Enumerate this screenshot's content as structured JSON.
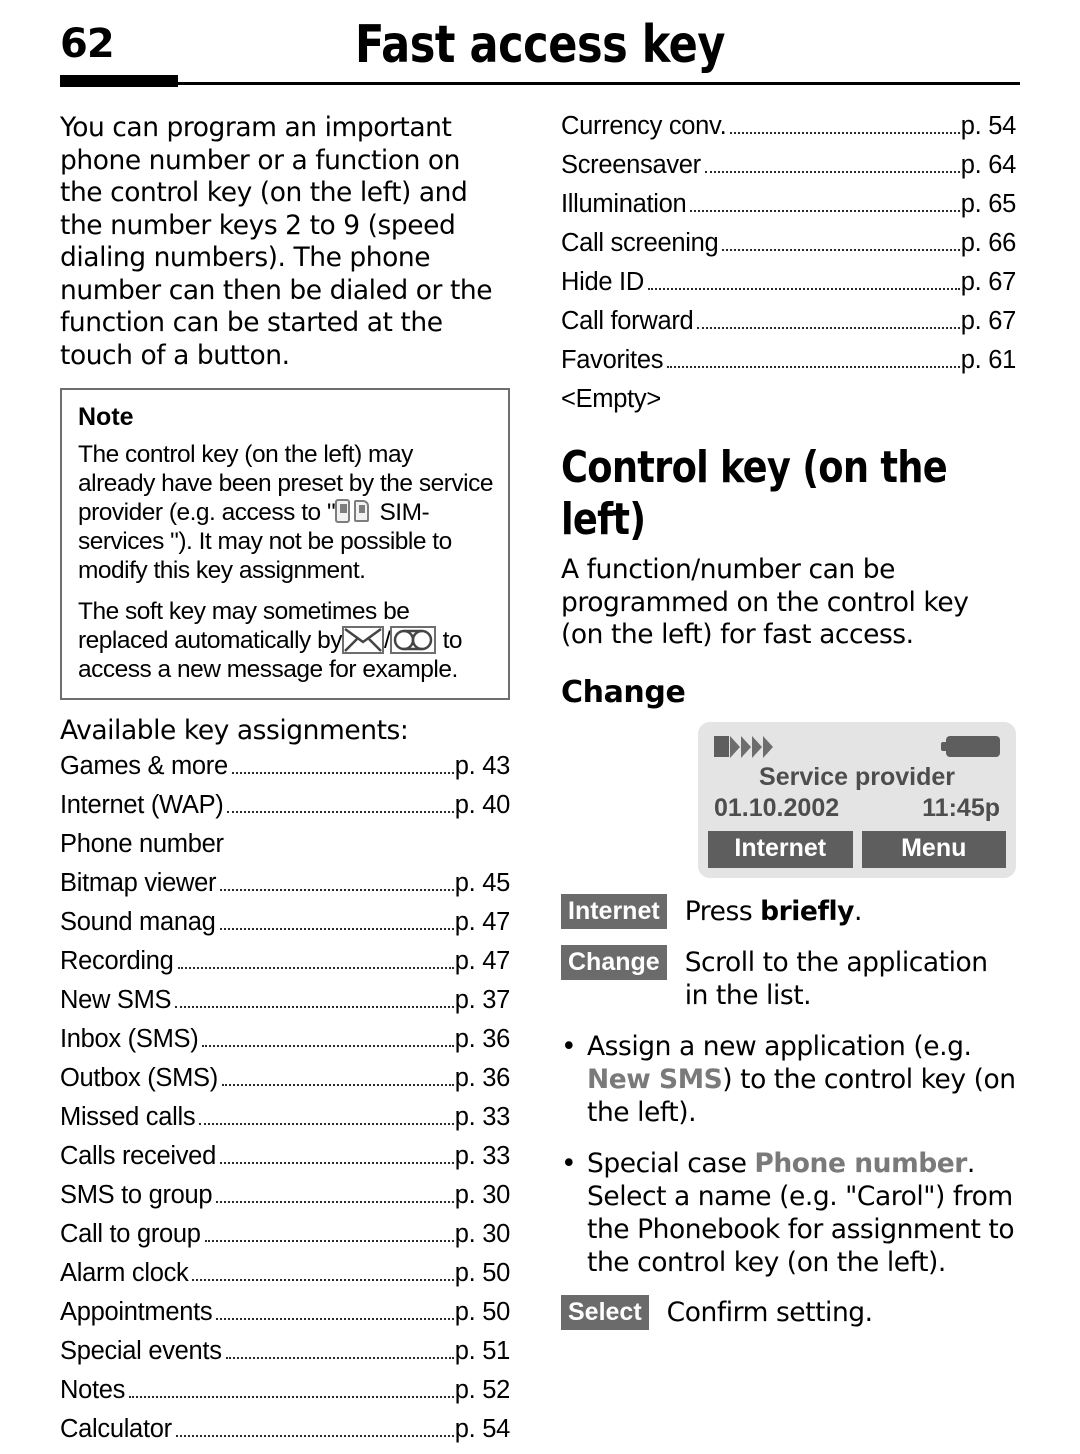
{
  "header": {
    "page_number": "62",
    "title": "Fast access key"
  },
  "left_column": {
    "intro": "You can program an important phone number or a function on the control key (on the left) and the number keys 2 to 9 (speed dialing numbers). The phone number can then be dialed or the function can be started at the touch of a button.",
    "note": {
      "heading": "Note",
      "paragraph1_part1": "The control key (on the left) may already have been preset by the service provider (e.g. access to \"",
      "sim_icon": "sim-services-icon",
      "paragraph1_part2": " SIM-services \"). It may not be possible to modify this key assignment.",
      "paragraph2_part1": "The soft key may sometimes be replaced automatically by",
      "envelope_icon": "envelope-icon",
      "separator": "/",
      "voicemail_icon": "voicemail-icon",
      "paragraph2_part2": "to access a new message for example."
    },
    "assignments_heading": "Available key assignments:",
    "assignments": [
      {
        "label": "Games & more",
        "page": "p. 43"
      },
      {
        "label": "Internet (WAP)",
        "page": "p. 40"
      },
      {
        "label": "Phone number",
        "page": ""
      },
      {
        "label": "Bitmap viewer",
        "page": "p. 45"
      },
      {
        "label": "Sound manag",
        "page": "p. 47"
      },
      {
        "label": "Recording",
        "page": "p. 47"
      },
      {
        "label": "New SMS",
        "page": "p. 37"
      },
      {
        "label": "Inbox (SMS)",
        "page": "p. 36"
      },
      {
        "label": "Outbox (SMS)",
        "page": "p. 36"
      },
      {
        "label": "Missed calls",
        "page": "p. 33"
      },
      {
        "label": "Calls received",
        "page": "p. 33"
      },
      {
        "label": "SMS to group",
        "page": "p. 30"
      },
      {
        "label": "Call to group",
        "page": "p. 30"
      },
      {
        "label": "Alarm clock",
        "page": "p. 50"
      },
      {
        "label": "Appointments",
        "page": "p. 50"
      },
      {
        "label": "Special events",
        "page": "p. 51"
      },
      {
        "label": "Notes",
        "page": "p. 52"
      },
      {
        "label": "Calculator",
        "page": "p. 54"
      }
    ]
  },
  "right_column": {
    "assignments": [
      {
        "label": "Currency conv.",
        "page": "p. 54"
      },
      {
        "label": "Screensaver",
        "page": "p. 64"
      },
      {
        "label": "Illumination",
        "page": "p. 65"
      },
      {
        "label": "Call screening",
        "page": "p. 66"
      },
      {
        "label": "Hide ID",
        "page": "p. 67"
      },
      {
        "label": "Call forward",
        "page": "p. 67"
      },
      {
        "label": "Favorites",
        "page": "p. 61"
      },
      {
        "label": "<Empty>",
        "page": ""
      }
    ],
    "section_heading": "Control key (on the left)",
    "section_body": "A function/number can be programmed on the control key (on the left) for fast access.",
    "change_heading": "Change",
    "phone": {
      "signal_icon": "signal-strength-icon",
      "battery_icon": "battery-icon",
      "provider": "Service provider",
      "date": "01.10.2002",
      "time": "11:45p",
      "softkey_left": "Internet",
      "softkey_right": "Menu"
    },
    "steps": [
      {
        "badge": "Internet",
        "text_before": "Press ",
        "text_bold": "briefly",
        "text_after": "."
      },
      {
        "badge": "Change",
        "text_before": "Scroll to the application in the list.",
        "text_bold": "",
        "text_after": ""
      }
    ],
    "bullets": [
      {
        "marker": "•",
        "part1": "Assign a new application (e.g. ",
        "term": "New SMS",
        "part2": ") to the control key (on the left)."
      },
      {
        "marker": "•",
        "part1": "Special case ",
        "term": "Phone number",
        "part2": ". Select a name (e.g. \"Carol\") from the Phonebook for assignment to  the control key (on the left)."
      }
    ],
    "final_step": {
      "badge": "Select",
      "text": "Confirm setting."
    },
    "colors": {
      "softkey_bg": "#6b6b6b",
      "phone_panel": "#e4e4e4",
      "phone_key": "#5e5e5e",
      "menu_term": "#7a7a7a"
    }
  }
}
